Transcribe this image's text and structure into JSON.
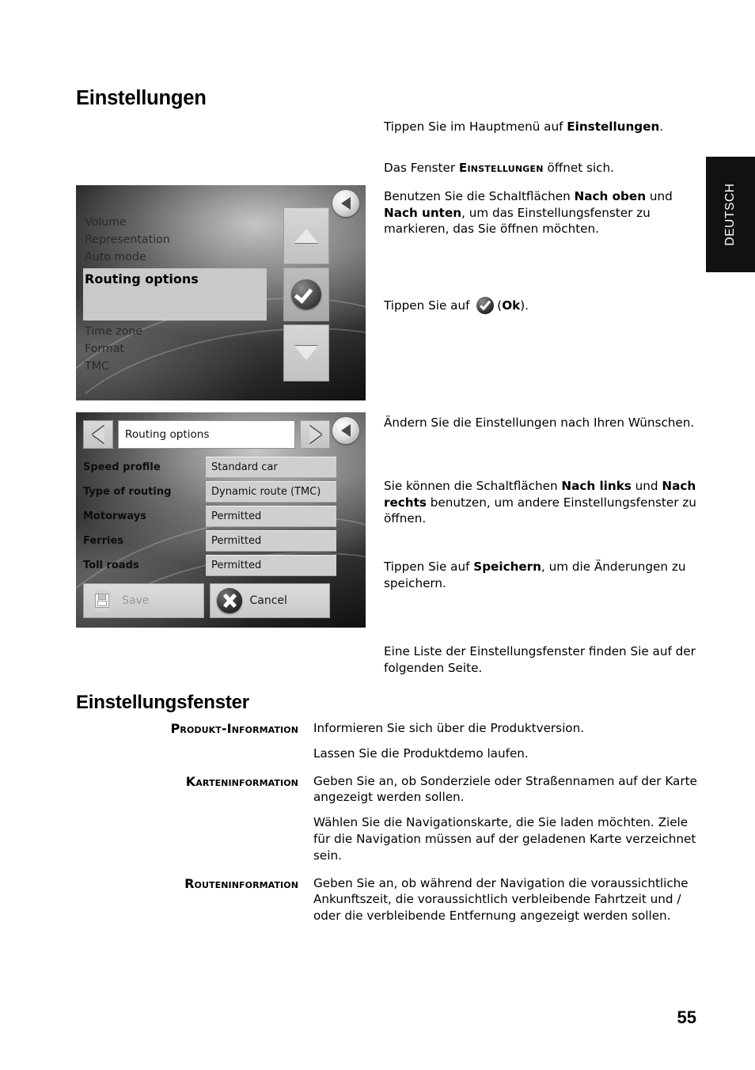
{
  "page": {
    "number": "55",
    "side_tab_label": "DEUTSCH"
  },
  "headings": {
    "main": "Einstellungen",
    "section": "Einstellungsfenster"
  },
  "instructions": {
    "block1_line1_pre": "Tippen Sie im Hauptmenü auf ",
    "block1_line1_bold": "Einstellungen",
    "block1_line1_post": ".",
    "block2_pre": "Das Fenster ",
    "block2_caps": "Einstellungen",
    "block2_post": " öffnet sich.",
    "block3_pre": "Benutzen Sie die Schaltflächen ",
    "block3_bold1": "Nach oben",
    "block3_mid": " und ",
    "block3_bold2": "Nach unten",
    "block3_post": ", um das Einstellungsfenster zu markieren, das Sie öffnen möchten.",
    "block4_pre": "Tippen Sie auf ",
    "block4_paren_open": "(",
    "block4_bold": "Ok",
    "block4_paren_close": ").",
    "block5": "Ändern Sie die Einstellungen nach Ihren Wünschen.",
    "block6_pre": "Sie können die Schaltflächen ",
    "block6_bold1": "Nach links",
    "block6_mid": " und ",
    "block6_bold2": "Nach rechts",
    "block6_post": " benutzen, um andere Einstellungsfenster zu öffnen.",
    "block7_pre": "Tippen Sie auf ",
    "block7_bold": "Speichern",
    "block7_post": ", um die Änderungen zu speichern.",
    "block8": "Eine Liste der Einstellungsfenster finden Sie auf der folgenden Seite."
  },
  "screenshot1": {
    "items_above": [
      "Volume",
      "Representation",
      "Auto mode"
    ],
    "selected_item": "Routing options",
    "items_below": [
      "Time zone",
      "Format",
      "TMC"
    ],
    "buttons": {
      "up": "up-arrow",
      "ok": "ok-check",
      "down": "down-arrow",
      "back": "back-arrow"
    }
  },
  "screenshot2": {
    "title": "Routing options",
    "rows": [
      {
        "label": "Speed profile",
        "value": "Standard car"
      },
      {
        "label": "Type of routing",
        "value": "Dynamic route (TMC)"
      },
      {
        "label": "Motorways",
        "value": "Permitted"
      },
      {
        "label": "Ferries",
        "value": "Permitted"
      },
      {
        "label": "Toll roads",
        "value": "Permitted"
      }
    ],
    "actions": {
      "save": "Save",
      "cancel": "Cancel"
    }
  },
  "settings_windows": [
    {
      "term": "Produkt-Information",
      "paragraphs": [
        "Informieren Sie sich über die Produktversion.",
        "Lassen Sie die Produktdemo laufen."
      ]
    },
    {
      "term": "Karteninformation",
      "paragraphs": [
        "Geben Sie an, ob Sonderziele oder Straßennamen auf der Karte angezeigt werden sollen.",
        "Wählen Sie die Navigationskarte, die Sie laden möchten. Ziele für die Navigation müssen auf der geladenen Karte verzeichnet sein."
      ]
    },
    {
      "term": "Routeninformation",
      "paragraphs": [
        "Geben Sie an, ob während der Navigation die voraussichtliche Ankunftszeit, die voraussichtlich verbleibende Fahrtzeit und / oder die verbleibende Entfernung angezeigt werden sollen."
      ]
    }
  ],
  "colors": {
    "tab_background": "#111111",
    "tab_text": "#ffffff",
    "selected_row": "#c9c9c9",
    "value_field": "#cfcfcf"
  }
}
